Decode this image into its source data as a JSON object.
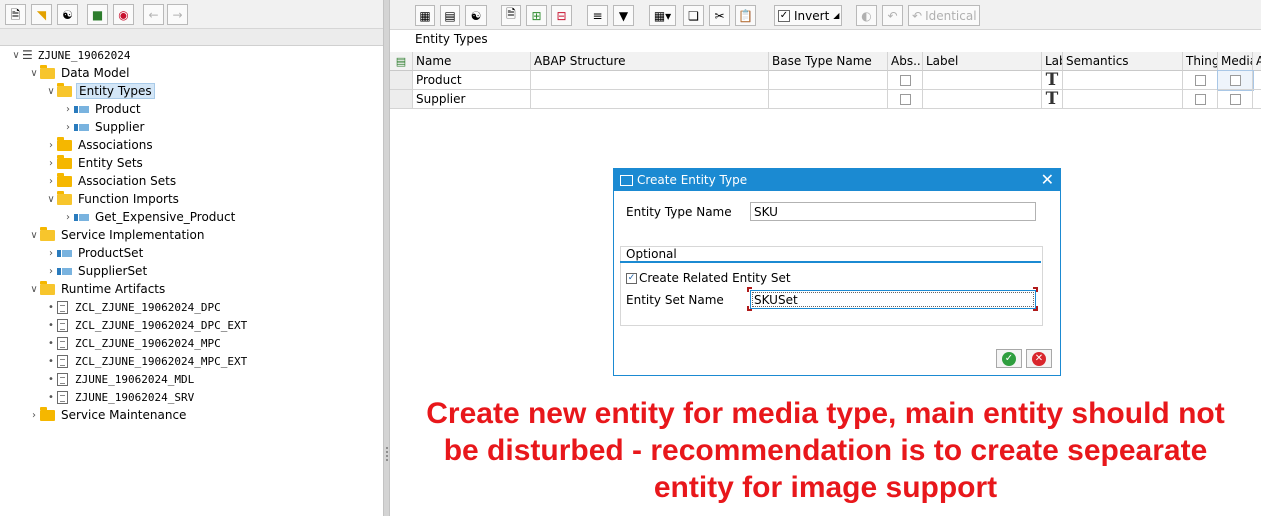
{
  "tree": {
    "root": "ZJUNE_19062024",
    "nodes": {
      "data_model": "Data Model",
      "entity_types": "Entity Types",
      "product": "Product",
      "supplier": "Supplier",
      "associations": "Associations",
      "entity_sets": "Entity Sets",
      "association_sets": "Association Sets",
      "function_imports": "Function Imports",
      "get_expensive_product": "Get_Expensive_Product",
      "service_implementation": "Service Implementation",
      "product_set": "ProductSet",
      "supplier_set": "SupplierSet",
      "runtime_artifacts": "Runtime Artifacts",
      "artifact_1": "ZCL_ZJUNE_19062024_DPC",
      "artifact_2": "ZCL_ZJUNE_19062024_DPC_EXT",
      "artifact_3": "ZCL_ZJUNE_19062024_MPC",
      "artifact_4": "ZCL_ZJUNE_19062024_MPC_EXT",
      "artifact_5": "ZJUNE_19062024_MDL",
      "artifact_6": "ZJUNE_19062024_SRV",
      "service_maintenance": "Service Maintenance"
    }
  },
  "right_toolbar": {
    "invert_label": "Invert",
    "identical_label": "Identical"
  },
  "panel": {
    "title": "Entity Types",
    "columns": {
      "name": "Name",
      "abap_structure": "ABAP Structure",
      "base_type_name": "Base Type Name",
      "abstract": "Abs...",
      "label": "Label",
      "lab": "Lab",
      "semantics": "Semantics",
      "thing": "Thing",
      "media": "Media",
      "more": "A"
    },
    "rows": [
      {
        "name": "Product"
      },
      {
        "name": "Supplier"
      }
    ]
  },
  "dialog": {
    "title": "Create Entity Type",
    "entity_type_name_label": "Entity Type Name",
    "entity_type_name_value": "SKU",
    "optional_label": "Optional",
    "create_related_label": "Create Related Entity Set",
    "entity_set_name_label": "Entity Set Name",
    "entity_set_name_value": "SKUSet"
  },
  "annotation": {
    "line1": "Create new entity for media type, main entity should not",
    "line2": "be disturbed - recommendation is to create sepearate",
    "line3": "entity for image support"
  },
  "colors": {
    "sap_blue": "#1b8ad2",
    "folder_yellow": "#f5b700",
    "annotation_red": "#e8171b",
    "ok_green": "#2e9e3e",
    "cancel_red": "#d9262c"
  }
}
